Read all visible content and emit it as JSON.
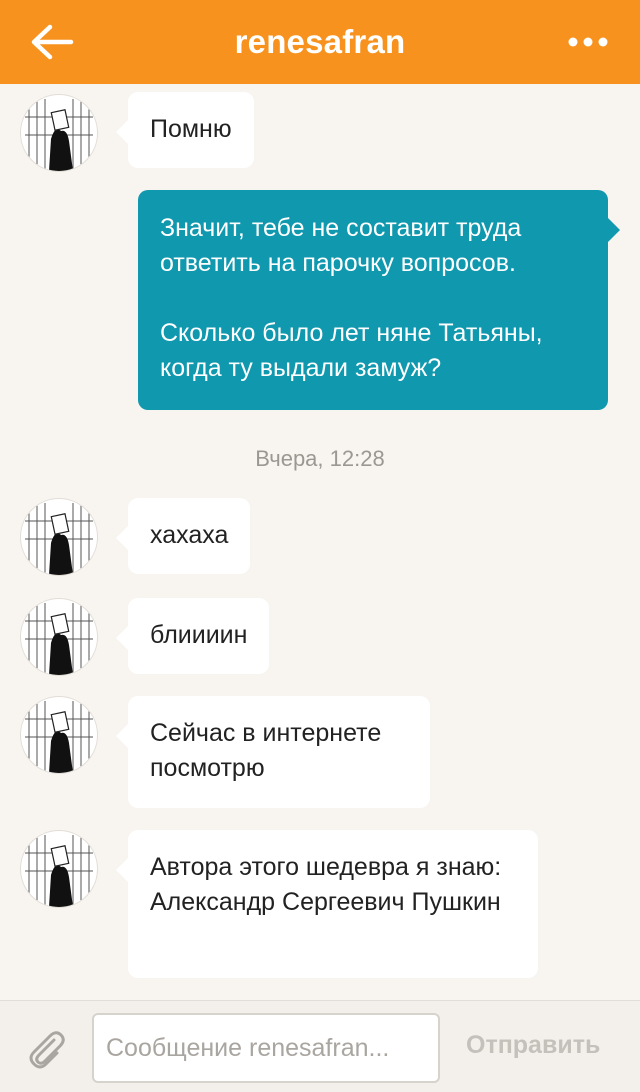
{
  "header": {
    "back_icon": "arrow-left-icon",
    "title": "renesafran",
    "more_icon": "more-dots-icon",
    "color": "#f7921e"
  },
  "messages": [
    {
      "direction": "in",
      "text": "Помню"
    },
    {
      "direction": "out",
      "text": "Значит, тебе не составит труда ответить на парочку вопросов.\n\nСколько было лет няне Татьяны, когда ту выдали замуж?"
    },
    {
      "type": "timestamp",
      "text": "Вчера, 12:28"
    },
    {
      "direction": "in",
      "text": "хахаха"
    },
    {
      "direction": "in",
      "text": "блиииин"
    },
    {
      "direction": "in",
      "text": "Сейчас в интернете посмотрю"
    },
    {
      "direction": "in",
      "text": "Автора этого шедевра я знаю: Александр Сергеевич Пушкин"
    }
  ],
  "composer": {
    "attach_icon": "paperclip-icon",
    "placeholder": "Сообщение renesafran...",
    "value": "",
    "send_label": "Отправить"
  },
  "colors": {
    "outgoing_bubble": "#0f98ae",
    "incoming_bubble": "#ffffff",
    "background": "#f8f5f1"
  }
}
